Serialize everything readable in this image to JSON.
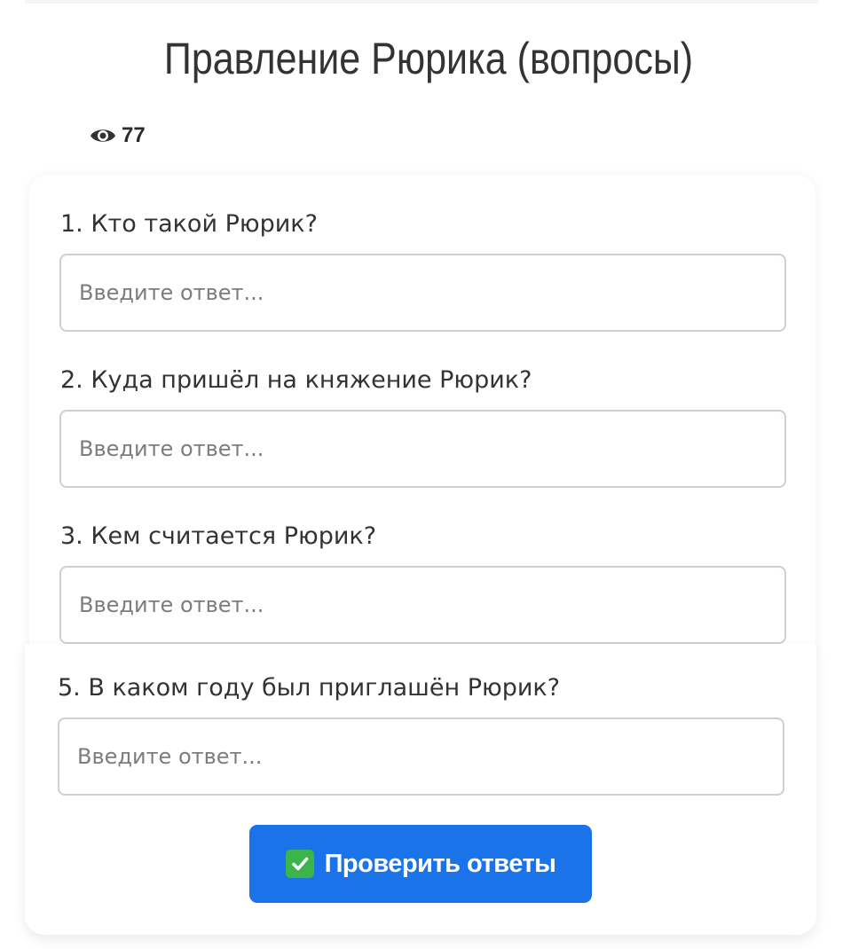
{
  "page": {
    "title": "Правление Рюрика (вопросы)"
  },
  "stats": {
    "views_icon": "eye-icon",
    "views_count": "77"
  },
  "questions": [
    {
      "label": "1. Кто такой Рюрик?",
      "value": "",
      "placeholder": "Введите ответ..."
    },
    {
      "label": "2. Куда пришёл на княжение Рюрик?",
      "value": "",
      "placeholder": "Введите ответ..."
    },
    {
      "label": "3. Кем считается Рюрик?",
      "value": "",
      "placeholder": "Введите ответ..."
    },
    {
      "label": "5. В каком году был приглашён Рюрик?",
      "value": "",
      "placeholder": "Введите ответ..."
    }
  ],
  "actions": {
    "check_icon": "check-mark-icon",
    "check_label": "Проверить ответы"
  },
  "colors": {
    "button": "#1a73e8",
    "check_icon": "#3bb54a"
  }
}
